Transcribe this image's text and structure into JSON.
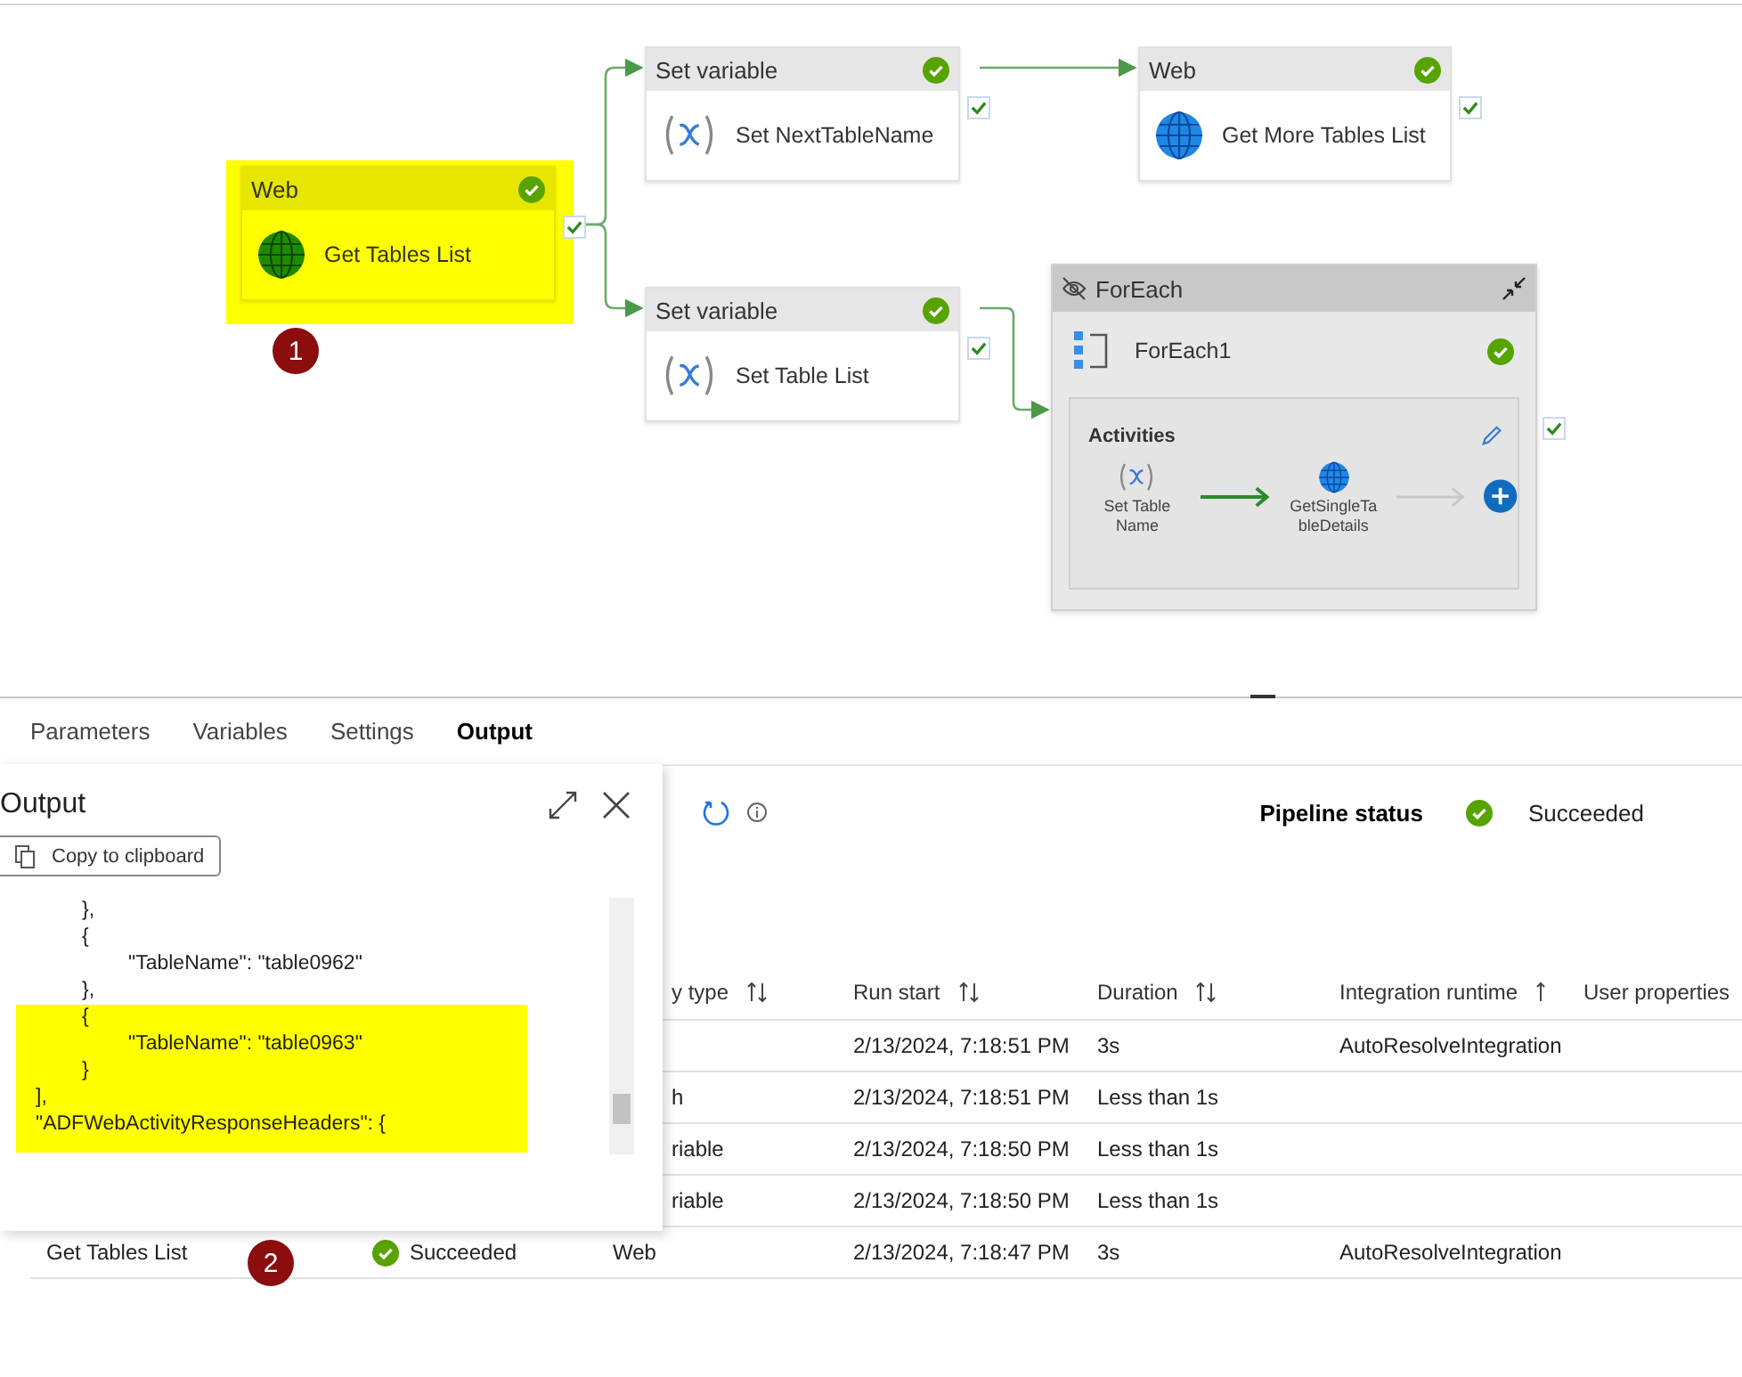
{
  "canvas": {
    "nodes": [
      {
        "kind": "web",
        "type": "Web",
        "name": "Get Tables List",
        "highlighted": true
      },
      {
        "kind": "variable",
        "type": "Set variable",
        "name": "Set NextTableName",
        "highlighted": false
      },
      {
        "kind": "web",
        "type": "Web",
        "name": "Get More Tables List",
        "highlighted": false
      },
      {
        "kind": "variable",
        "type": "Set variable",
        "name": "Set Table List",
        "highlighted": false
      },
      {
        "kind": "container",
        "type": "ForEach",
        "name": "ForEach1",
        "section": "Activities",
        "activities": [
          {
            "kind": "variable",
            "label": "Set Table Name"
          },
          {
            "kind": "web",
            "label": "GetSingleTableDetails"
          }
        ]
      }
    ],
    "badge": "1"
  },
  "tabs": [
    {
      "label": "Parameters",
      "selected": false
    },
    {
      "label": "Variables",
      "selected": false
    },
    {
      "label": "Settings",
      "selected": false
    },
    {
      "label": "Output",
      "selected": true
    }
  ],
  "pipeline_status": {
    "label": "Pipeline status",
    "value": "Succeeded"
  },
  "output_dialog": {
    "title": "Output",
    "copy_button": "Copy to clipboard",
    "lines": [
      {
        "text": "\t},",
        "highlighted": false
      },
      {
        "text": "\t{",
        "highlighted": false
      },
      {
        "text": "\t\t\"TableName\": \"table0962\"",
        "highlighted": false
      },
      {
        "text": "\t},",
        "highlighted": false
      },
      {
        "text": "\t{",
        "highlighted": true
      },
      {
        "text": "\t\t\"TableName\": \"table0963\"",
        "highlighted": true
      },
      {
        "text": "\t}",
        "highlighted": true
      },
      {
        "text": "],",
        "highlighted": true
      },
      {
        "text": "\"ADFWebActivityResponseHeaders\": {",
        "highlighted": true
      }
    ]
  },
  "table": {
    "columns": [
      {
        "label": "y type",
        "sortable": true,
        "sorted": false
      },
      {
        "label": "Run start",
        "sortable": true,
        "sorted": false
      },
      {
        "label": "Duration",
        "sortable": true,
        "sorted": false
      },
      {
        "label": "Integration runtime",
        "sortable": true,
        "sorted": true
      },
      {
        "label": "User properties"
      }
    ],
    "rows": [
      {
        "run_start": "2/13/2024, 7:18:51 PM",
        "duration": "3s",
        "runtime": "AutoResolveIntegration"
      },
      {
        "type": "h",
        "run_start": "2/13/2024, 7:18:51 PM",
        "duration": "Less than 1s"
      },
      {
        "type": "riable",
        "run_start": "2/13/2024, 7:18:50 PM",
        "duration": "Less than 1s"
      },
      {
        "type": "riable",
        "run_start": "2/13/2024, 7:18:50 PM",
        "duration": "Less than 1s"
      },
      {
        "name": "Get Tables List",
        "status": "Succeeded",
        "type": "Web",
        "run_start": "2/13/2024, 7:18:47 PM",
        "duration": "3s",
        "runtime": "AutoResolveIntegration"
      }
    ]
  },
  "badge": "2"
}
